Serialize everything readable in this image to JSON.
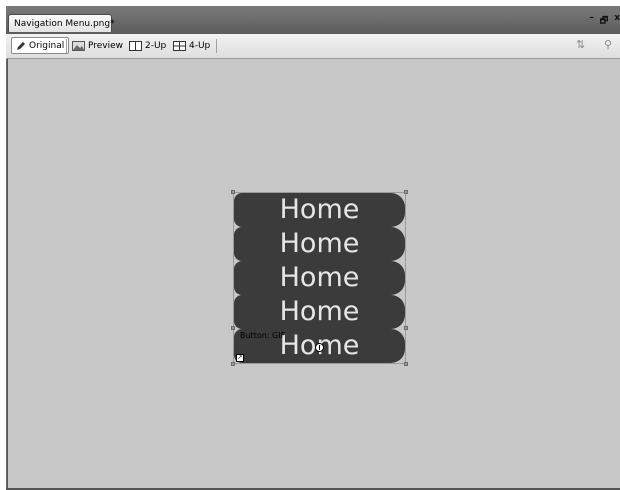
{
  "document_tab": {
    "title": "Navigation Menu.png*"
  },
  "window_controls": {
    "minimize": "–",
    "restore": "🗗",
    "close": "x"
  },
  "view_toolbar": {
    "original": "Original",
    "preview": "Preview",
    "two_up": "2-Up",
    "four_up": "4-Up"
  },
  "canvas": {
    "buttons": [
      {
        "label": "Home"
      },
      {
        "label": "Home"
      },
      {
        "label": "Home"
      },
      {
        "label": "Home"
      },
      {
        "label": "Home"
      }
    ],
    "slice_label": "Button: GIF"
  },
  "colors": {
    "canvas_bg": "#c8c8c8",
    "button_fill": "#3b3b3b",
    "button_text": "#e6e6e6"
  }
}
